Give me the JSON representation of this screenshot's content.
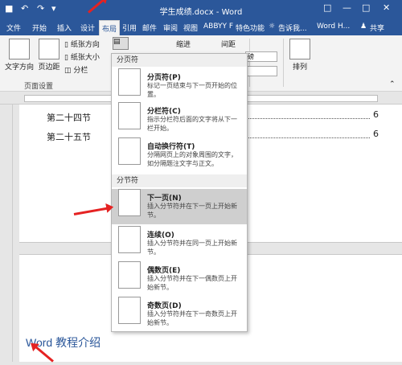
{
  "window": {
    "title": "学生成绩.docx - Word",
    "undo_symbol": "↶",
    "redo_symbol": "↷"
  },
  "tabs": [
    "文件",
    "开始",
    "插入",
    "设计",
    "布局",
    "引用",
    "邮件",
    "审阅",
    "视图",
    "ABBYY F",
    "特色功能"
  ],
  "tell_me": "告诉我...",
  "account": "Word H...",
  "share": "共享",
  "ribbon": {
    "text_direction": "文字方向",
    "margins": "页边距",
    "orientation": "纸张方向",
    "size": "纸张大小",
    "columns": "分栏",
    "page_setup": "页面设置",
    "indent": "缩进",
    "spacing": "间距",
    "spacing_unit": "磅",
    "arrange": "排列"
  },
  "document": {
    "toc": [
      {
        "label": "第二十四节",
        "page": "6"
      },
      {
        "label": "第二十五节",
        "page": "6"
      }
    ],
    "heading": "Word 教程介绍"
  },
  "breaks_menu": {
    "page_breaks_header": "分页符",
    "section_breaks_header": "分节符",
    "items": [
      {
        "title": "分页符(P)",
        "desc": "标记一页结束与下一页开始的位置。"
      },
      {
        "title": "分栏符(C)",
        "desc": "指示分栏符后面的文字将从下一栏开始。"
      },
      {
        "title": "自动换行符(T)",
        "desc": "分隔网页上的对象周围的文字，如分隔题注文字与正文。"
      },
      {
        "title": "下一页(N)",
        "desc": "插入分节符并在下一页上开始新节。"
      },
      {
        "title": "连续(O)",
        "desc": "插入分节符并在同一页上开始新节。"
      },
      {
        "title": "偶数页(E)",
        "desc": "插入分节符并在下一偶数页上开始新节。"
      },
      {
        "title": "奇数页(D)",
        "desc": "插入分节符并在下一奇数页上开始新节。"
      }
    ]
  },
  "colors": {
    "accent": "#2b579a",
    "annotation": "#e52222"
  }
}
